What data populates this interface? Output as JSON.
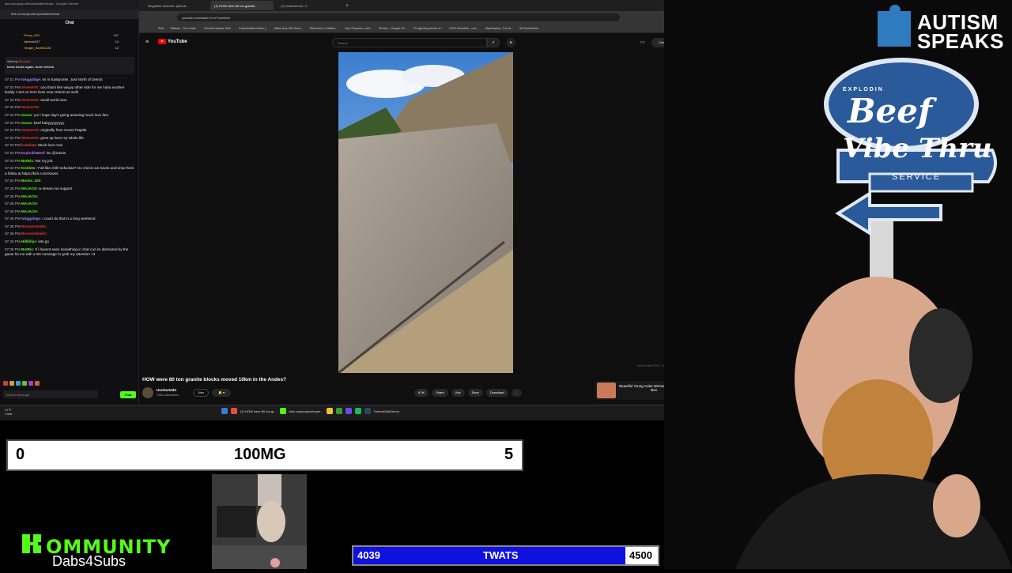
{
  "chat_window": {
    "title": "kick.com/popout/explodinbeef/chat - Google Chrome",
    "url": "kick.com/popout/explodinbeef/chat",
    "header": "Chat",
    "leaderboard": [
      {
        "name": "Pezzy_420",
        "count": "147"
      },
      {
        "name": "Jammin247",
        "count": "14"
      },
      {
        "name": "Yaeger_Bomb1228",
        "count": "12"
      }
    ],
    "pinned": {
      "label": "Sent by",
      "sender": "Electrab",
      "text": "kicks broke again. dont refresh"
    },
    "messages": [
      {
        "time": "07:31 PM",
        "user": "twiggybige",
        "color": "#9b8bff",
        "text": "im in Eastpointe. Just North of Detroit"
      },
      {
        "time": "07:32 PM",
        "user": "XtremeTK",
        "color": "#ff3030",
        "text": "ooo that's like wayyy other side for me haha another buddy I met on here lives near Detroit as well!"
      },
      {
        "time": "07:32 PM",
        "user": "XtremeTK",
        "color": "#ff3030",
        "text": "small world man"
      },
      {
        "time": "07:32 PM",
        "user": "XtremeTK",
        "color": "#ff3030",
        "text": ""
      },
      {
        "time": "07:32 PM",
        "user": "Xavss",
        "color": "#53fc18",
        "text": "yur i hope day's going amazing much love fam"
      },
      {
        "time": "07:32 PM",
        "user": "Xavss",
        "color": "#53fc18",
        "text": "beef babyyyyyyyyy"
      },
      {
        "time": "07:32 PM",
        "user": "XtremeTK",
        "color": "#ff3030",
        "text": "originally from Grand Rapids"
      },
      {
        "time": "07:32 PM",
        "user": "XtremeTK",
        "color": "#ff3030",
        "text": "grew up here my whole life"
      },
      {
        "time": "07:32 PM",
        "user": "ironclaw",
        "color": "#ff4040",
        "text": "Much love man"
      },
      {
        "time": "07:33 PM",
        "user": "ExplodinBeef",
        "color": "#c070ff",
        "text": "iso @Xavss"
      },
      {
        "time": "07:33 PM",
        "user": "BotRix",
        "color": "#53fc18",
        "text": "Not my job."
      },
      {
        "time": "07:33 PM",
        "user": "Kicklets",
        "color": "#53fc18",
        "text": "Y'all like chill mofuckas? Go check out Xavss and drop them a follow at https://kick.com/Xavss"
      },
      {
        "time": "07:34 PM",
        "user": "Bocha_420",
        "color": "#53fc18",
        "text": ""
      },
      {
        "time": "07:35 PM",
        "user": "MAJACH",
        "color": "#53fc18",
        "text": "w stream ws support"
      },
      {
        "time": "07:35 PM",
        "user": "MAJACH",
        "color": "#53fc18",
        "text": ""
      },
      {
        "time": "07:35 PM",
        "user": "MAJACH",
        "color": "#53fc18",
        "text": ""
      },
      {
        "time": "07:35 PM",
        "user": "MAJACH",
        "color": "#53fc18",
        "text": ""
      },
      {
        "time": "07:36 PM",
        "user": "twiggybige",
        "color": "#9b8bff",
        "text": "i could do that in a long weekend"
      },
      {
        "time": "07:36 PM",
        "user": "BronxGremlin",
        "color": "#ff3030",
        "text": ""
      },
      {
        "time": "07:36 PM",
        "user": "BronxGremlin",
        "color": "#ff3030",
        "text": ""
      },
      {
        "time": "07:36 PM",
        "user": "Hillbillys",
        "color": "#53fc18",
        "text": "lets go"
      },
      {
        "time": "07:36 PM",
        "user": "BotRix",
        "color": "#53fc18",
        "text": "If i havent seen something in chat cuz im distracted by the game hit me with a !tts message to grab my attention <3"
      }
    ],
    "input_placeholder": "Send a message",
    "send_label": "Chat"
  },
  "browser": {
    "tabs": [
      {
        "label": "Megalithic Marvels: @iterat..."
      },
      {
        "label": "(1) HOW were 80 ton granite...",
        "active": true
      },
      {
        "label": "(3) Notifications / X"
      }
    ],
    "url": "youtube.com/watch?v=n7mxetvzfc",
    "bookmarks": [
      "Kick",
      "Statsus - The Lead...",
      "Internet Speed Test...",
      "ExplodinBeef Bars |...",
      "Make Any Mic Soun...",
      "Welcome to Oklaho...",
      "Your Purpose | clot...",
      "Photos - Google Ph...",
      "Fix gaming issues w...",
      "KICK Bounties - ove...",
      "Mylebrants | The la...",
      "All Bookmarks"
    ],
    "youtube": {
      "logo": "YouTube",
      "search_placeholder": "Search",
      "create_label": "Create",
      "avatar_initial": "E",
      "watermark": "UNCHARTED X.COM",
      "video_title": "HOW were 80 ton granite blocks moved 10km in the Andes?",
      "channel_name": "UnchartedX",
      "channel_subs": "703K subscribers",
      "join_label": "Join",
      "actions": [
        "8.3K",
        "Share",
        "Ask",
        "Save",
        "Download",
        "..."
      ],
      "ad_text": "Beautiful Young Asian Women Seeking Older Men"
    }
  },
  "taskbar": {
    "weather_temp": "47°F",
    "weather_desc": "Clear",
    "items": [
      "(1) HOW were 80 ton gr...",
      "kick.com/popout/explo...",
      "TwinsofOkieDemo"
    ],
    "time": "7:40 PM",
    "date": "2/3/2026"
  },
  "overlay": {
    "counter": {
      "left": "0",
      "middle": "100MG",
      "right": "5"
    },
    "goal": {
      "current": "4039",
      "label": "TWATS",
      "target": "4500",
      "progress": 0.8976
    },
    "kommunity": {
      "title": "OMMUNITY",
      "subtitle": "Dabs4Subs"
    },
    "autism_speaks": {
      "line1": "AUTISM",
      "line2": "SPEAKS"
    },
    "beef_sign": {
      "top": "EXPLODIN",
      "main": "Beef",
      "vibe": "Vibe Thru",
      "service": "SERVICE"
    }
  },
  "colors": {
    "kick_green": "#53fc18",
    "goal_blue": "#1010e0",
    "youtube_red": "#ff0000"
  }
}
